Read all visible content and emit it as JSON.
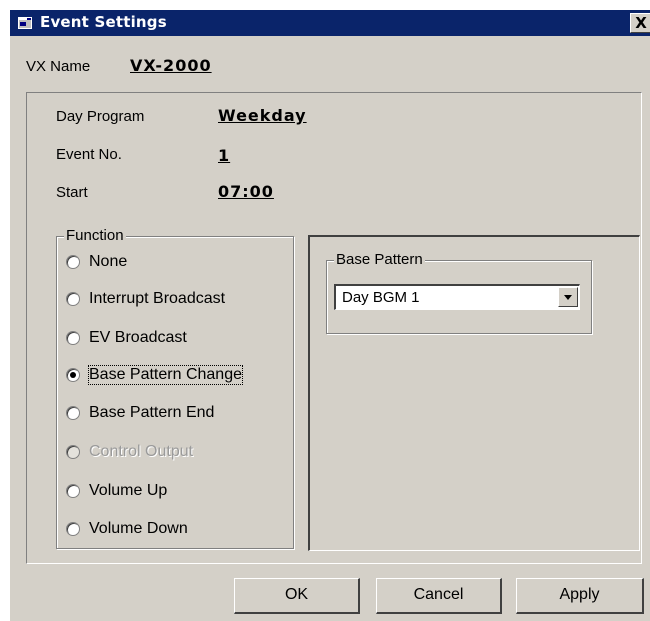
{
  "window": {
    "title": "Event Settings",
    "close_label": "X"
  },
  "vx_name": {
    "label": "VX Name",
    "value": "VX-2000"
  },
  "info": {
    "day_program": {
      "label": "Day Program",
      "value": "Weekday"
    },
    "event_no": {
      "label": "Event No.",
      "value": "1"
    },
    "start": {
      "label": "Start",
      "value": "07:00"
    }
  },
  "function": {
    "legend": "Function",
    "options": [
      {
        "label": "None",
        "selected": false,
        "enabled": true
      },
      {
        "label": "Interrupt Broadcast",
        "selected": false,
        "enabled": true
      },
      {
        "label": "EV Broadcast",
        "selected": false,
        "enabled": true
      },
      {
        "label": "Base Pattern Change",
        "selected": true,
        "enabled": true
      },
      {
        "label": "Base Pattern End",
        "selected": false,
        "enabled": true
      },
      {
        "label": "Control Output",
        "selected": false,
        "enabled": false
      },
      {
        "label": "Volume Up",
        "selected": false,
        "enabled": true
      },
      {
        "label": "Volume Down",
        "selected": false,
        "enabled": true
      }
    ]
  },
  "base_pattern": {
    "legend": "Base Pattern",
    "selected": "Day BGM 1"
  },
  "buttons": {
    "ok": "OK",
    "cancel": "Cancel",
    "apply": "Apply"
  },
  "colors": {
    "titlebar": "#0a246a",
    "face": "#d4d0c8",
    "shadow": "#808080",
    "highlight": "#ffffff"
  }
}
